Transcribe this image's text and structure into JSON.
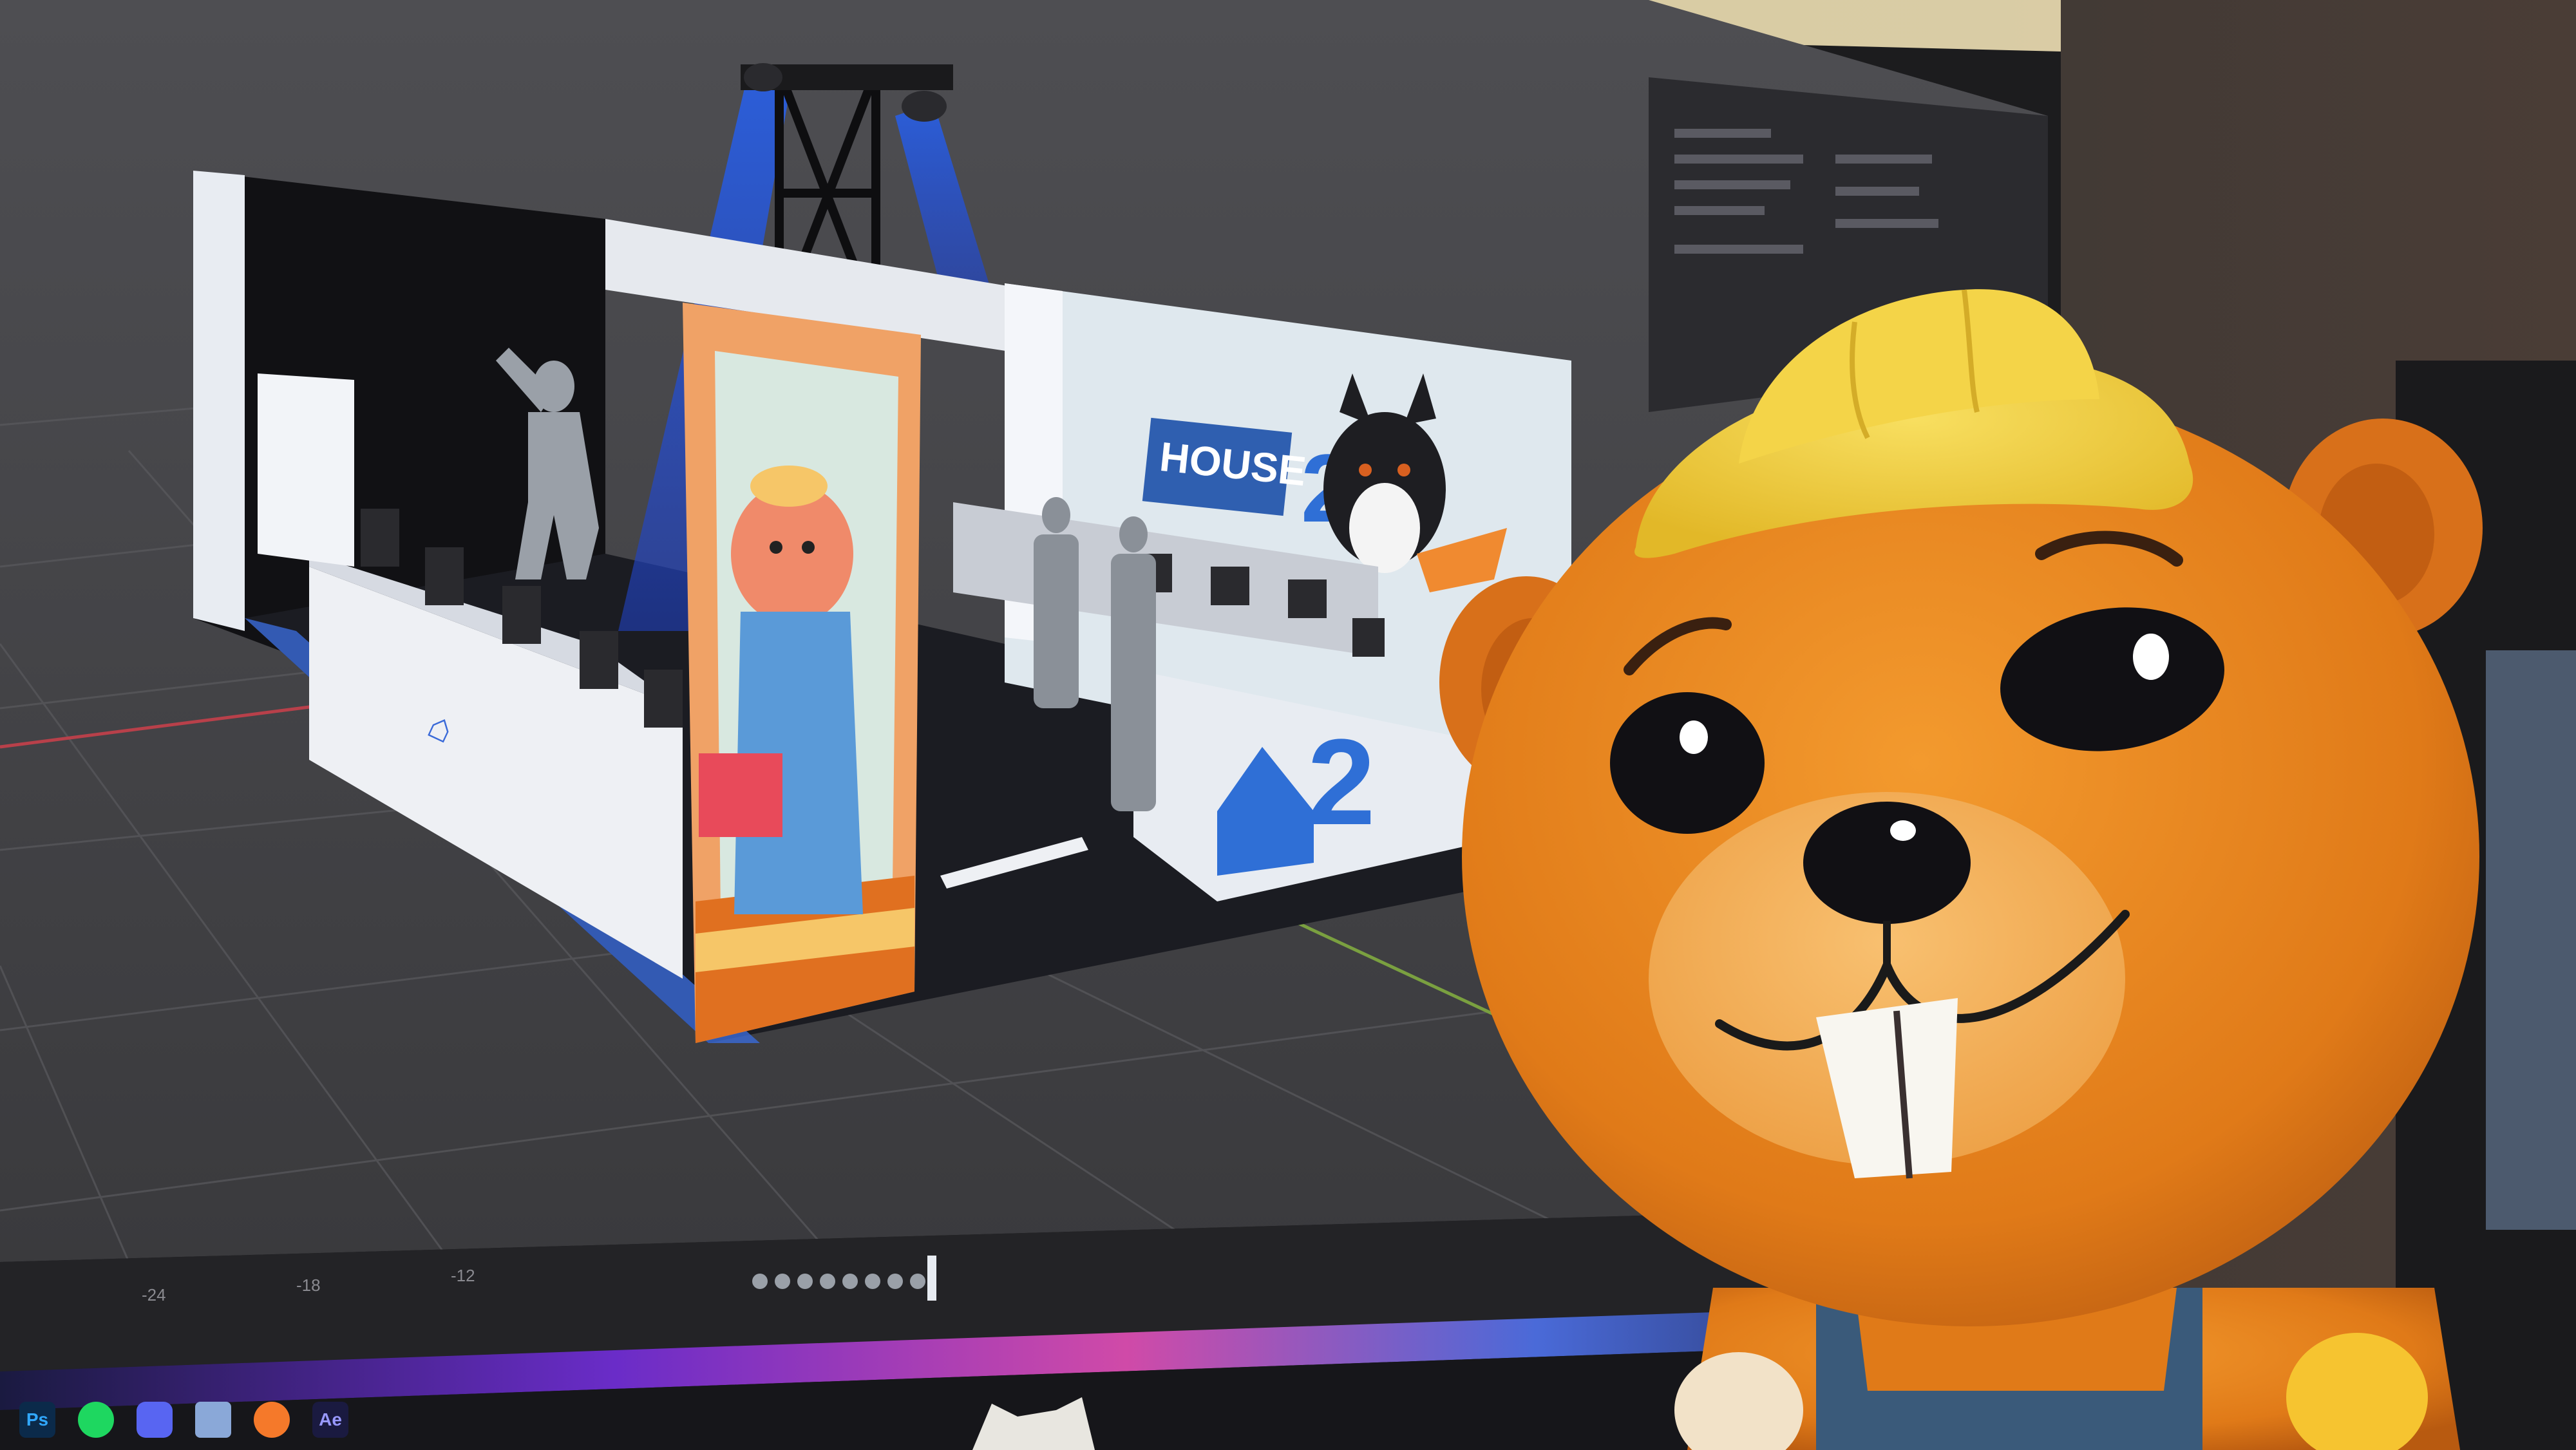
{
  "photo": {
    "subject": "plush beaver mascot in front of monitor",
    "colors": {
      "plush_orange": "#e8801e",
      "plush_light": "#f6b25a",
      "hat_yellow": "#f5d040",
      "overalls_blue": "#3a5a7a",
      "viewport_bg": "#4a4a4e",
      "booth_white": "#eef0f4",
      "accent_blue": "#2f6fd6"
    }
  },
  "monitor": {
    "app": {
      "viewport": {
        "booth_logo_text": "HOUSE",
        "booth_logo_number": "2",
        "counter_logo_number": "2"
      },
      "timeline": {
        "frame_labels": [
          "-24",
          "-18",
          "-12"
        ]
      },
      "taskbar": {
        "icons": [
          {
            "name": "photoshop-icon",
            "label": "Ps",
            "color": "#31a8ff"
          },
          {
            "name": "spotify-icon",
            "label": "",
            "color": "#1ed760"
          },
          {
            "name": "discord-icon",
            "label": "",
            "color": "#5865f2"
          },
          {
            "name": "files-icon",
            "label": "",
            "color": "#8aa8d8"
          },
          {
            "name": "blender-icon",
            "label": "",
            "color": "#f5792a"
          },
          {
            "name": "after-effects-icon",
            "label": "Ae",
            "color": "#9999ff"
          }
        ]
      }
    }
  }
}
